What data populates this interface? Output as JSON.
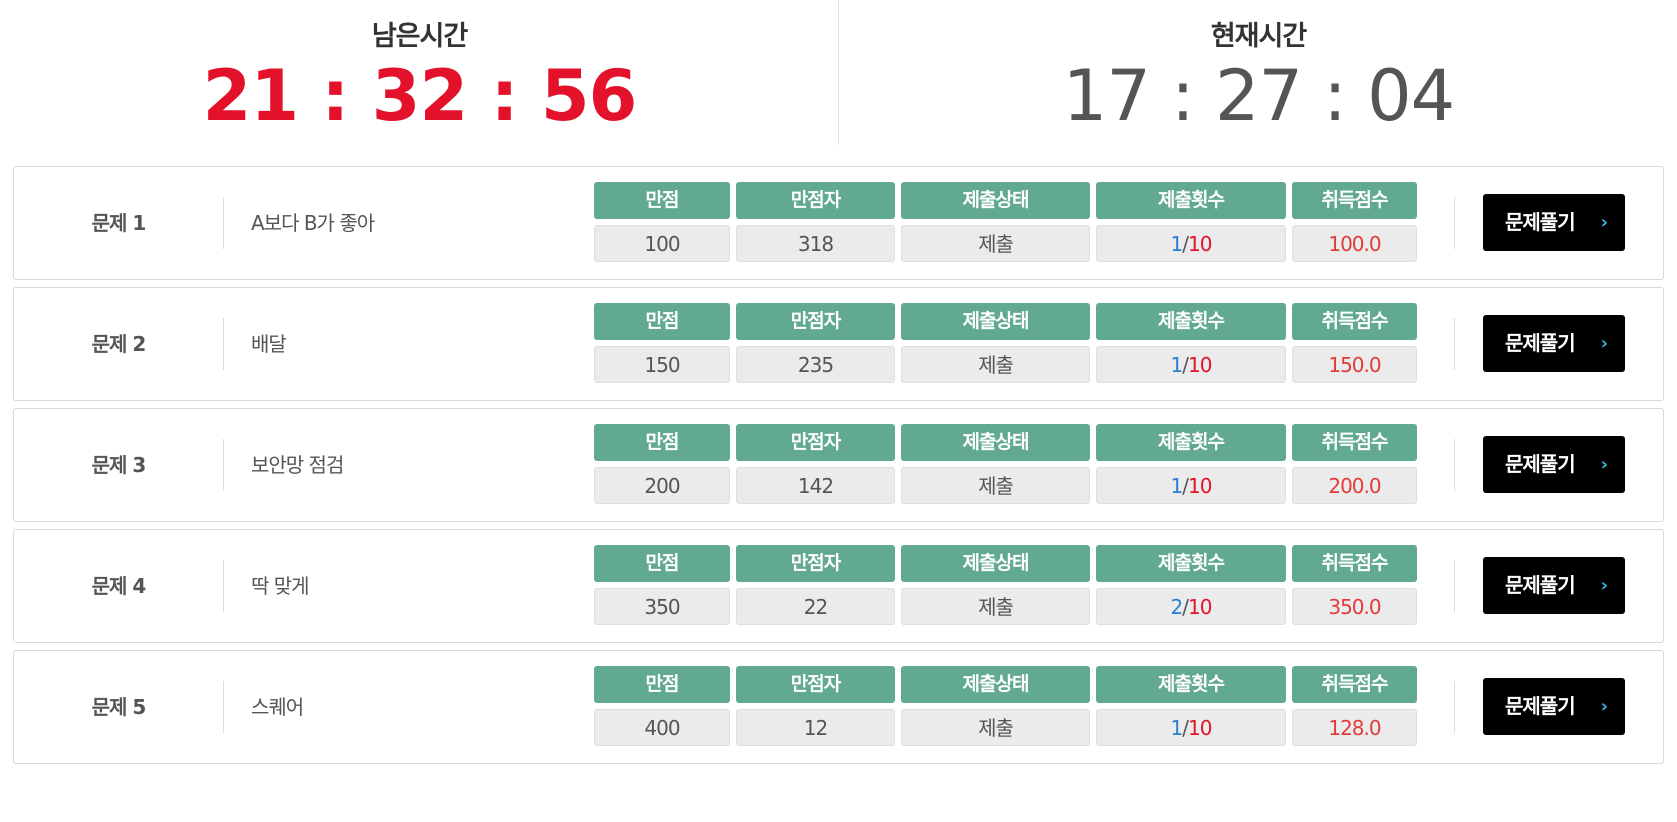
{
  "timers": {
    "remaining_label": "남은시간",
    "remaining_value": "21 : 32 : 56",
    "current_label": "현재시간",
    "current_value": "17 : 27 : 04"
  },
  "columns": [
    "만점",
    "만점자",
    "제출상태",
    "제출횟수",
    "취득점수"
  ],
  "solve_label": "문제풀기",
  "solve_chevron": "›",
  "colors": {
    "accent_red": "#e4112a",
    "header_green": "#62aa8f",
    "count_blue": "#2a7fd4",
    "button_black": "#000000"
  },
  "problems": [
    {
      "num": "문제 1",
      "title": "A보다 B가 좋아",
      "max": "100",
      "perfect": "318",
      "status": "제출",
      "count": "1",
      "slash": "/",
      "count_max": "10",
      "score": "100.0"
    },
    {
      "num": "문제 2",
      "title": "배달",
      "max": "150",
      "perfect": "235",
      "status": "제출",
      "count": "1",
      "slash": "/",
      "count_max": "10",
      "score": "150.0"
    },
    {
      "num": "문제 3",
      "title": "보안망 점검",
      "max": "200",
      "perfect": "142",
      "status": "제출",
      "count": "1",
      "slash": "/",
      "count_max": "10",
      "score": "200.0"
    },
    {
      "num": "문제 4",
      "title": "딱 맞게",
      "max": "350",
      "perfect": "22",
      "status": "제출",
      "count": "2",
      "slash": "/",
      "count_max": "10",
      "score": "350.0"
    },
    {
      "num": "문제 5",
      "title": "스퀘어",
      "max": "400",
      "perfect": "12",
      "status": "제출",
      "count": "1",
      "slash": "/",
      "count_max": "10",
      "score": "128.0"
    }
  ]
}
